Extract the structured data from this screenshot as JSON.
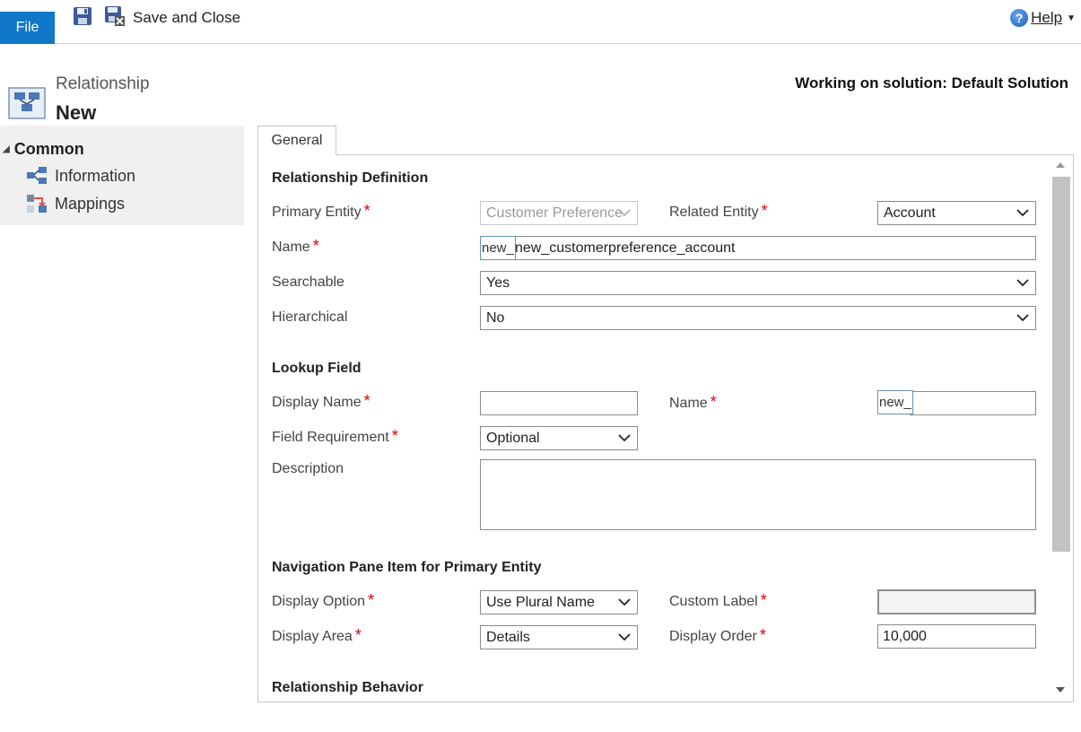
{
  "toolbar": {
    "file_label": "File",
    "save_close_label": "Save and Close",
    "help_label": "Help",
    "save_icon": "save-icon",
    "save_close_icon": "save-close-icon"
  },
  "header": {
    "entity_type": "Relationship",
    "title": "New",
    "solution_text": "Working on solution: Default Solution"
  },
  "nav": {
    "group_label": "Common",
    "items": [
      {
        "label": "Information",
        "icon": "information-icon"
      },
      {
        "label": "Mappings",
        "icon": "mappings-icon"
      }
    ]
  },
  "tabs": {
    "general": "General"
  },
  "required_marker": "*",
  "sections": {
    "definition": {
      "title": "Relationship Definition",
      "primary_entity_label": "Primary Entity",
      "primary_entity_value": "Customer Preference",
      "related_entity_label": "Related Entity",
      "related_entity_value": "Account",
      "name_label": "Name",
      "name_prefix": "new_",
      "name_value": "new_customerpreference_account",
      "searchable_label": "Searchable",
      "searchable_value": "Yes",
      "hierarchical_label": "Hierarchical",
      "hierarchical_value": "No"
    },
    "lookup": {
      "title": "Lookup Field",
      "display_name_label": "Display Name",
      "display_name_value": "",
      "name_label": "Name",
      "name_prefix": "new_",
      "name_value": "",
      "field_requirement_label": "Field Requirement",
      "field_requirement_value": "Optional",
      "description_label": "Description"
    },
    "navigation": {
      "title": "Navigation Pane Item for Primary Entity",
      "display_option_label": "Display Option",
      "display_option_value": "Use Plural Name",
      "custom_label_label": "Custom Label",
      "custom_label_value": "",
      "display_area_label": "Display Area",
      "display_area_value": "Details",
      "display_order_label": "Display Order",
      "display_order_value": "10,000"
    },
    "behavior": {
      "title": "Relationship Behavior"
    }
  },
  "colors": {
    "file_button": "#1077c9",
    "required": "#e00000",
    "nav_background": "#f0f0f0"
  }
}
